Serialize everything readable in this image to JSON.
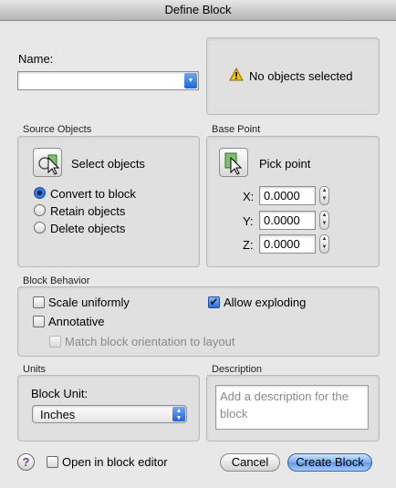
{
  "window": {
    "title": "Define Block"
  },
  "name": {
    "label": "Name:",
    "value": ""
  },
  "preview": {
    "message": "No objects selected",
    "icon": "warning-icon"
  },
  "source_objects": {
    "title": "Source Objects",
    "select_label": "Select objects",
    "options": [
      "Convert to block",
      "Retain objects",
      "Delete objects"
    ],
    "selected_index": 0
  },
  "base_point": {
    "title": "Base Point",
    "pick_label": "Pick point",
    "x_label": "X:",
    "x_value": "0.0000",
    "y_label": "Y:",
    "y_value": "0.0000",
    "z_label": "Z:",
    "z_value": "0.0000"
  },
  "behavior": {
    "title": "Block Behavior",
    "scale_uniformly": {
      "label": "Scale uniformly",
      "checked": false
    },
    "annotative": {
      "label": "Annotative",
      "checked": false
    },
    "match_orientation": {
      "label": "Match block orientation to layout",
      "checked": false,
      "enabled": false
    },
    "allow_exploding": {
      "label": "Allow exploding",
      "checked": true
    }
  },
  "units": {
    "title": "Units",
    "block_unit_label": "Block Unit:",
    "block_unit_value": "Inches"
  },
  "description": {
    "title": "Description",
    "placeholder": "Add a description for the block"
  },
  "footer": {
    "help_label": "?",
    "open_in_editor": {
      "label": "Open in block editor",
      "checked": false
    },
    "cancel_label": "Cancel",
    "create_label": "Create Block"
  },
  "colors": {
    "accent": "#2c6cd8",
    "warning": "#f2c20f"
  }
}
